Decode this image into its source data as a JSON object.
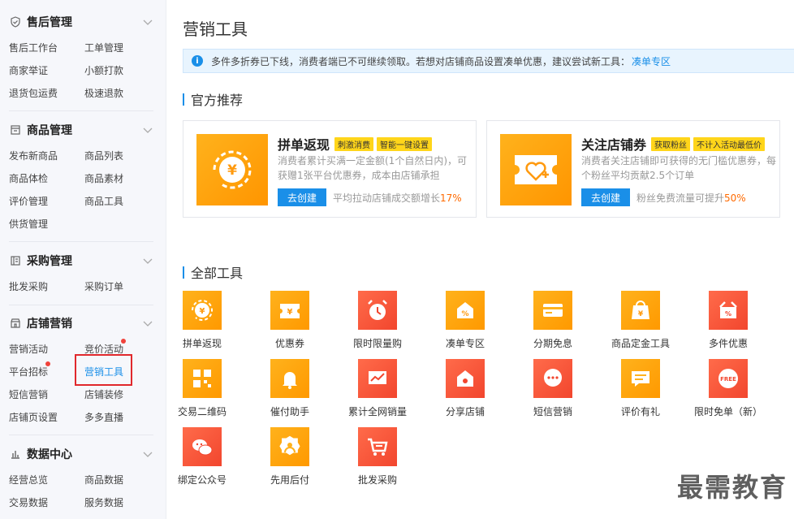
{
  "sidebar": {
    "sections": [
      {
        "title": "售后管理",
        "icon": "shield-check-icon",
        "items": [
          "售后工作台",
          "工单管理",
          "商家举证",
          "小额打款",
          "退货包运费",
          "极速退款"
        ]
      },
      {
        "title": "商品管理",
        "icon": "box-icon",
        "items": [
          "发布新商品",
          "商品列表",
          "商品体检",
          "商品素材",
          "评价管理",
          "商品工具",
          "供货管理"
        ]
      },
      {
        "title": "采购管理",
        "icon": "list-icon",
        "items": [
          "批发采购",
          "采购订单"
        ]
      },
      {
        "title": "店铺营销",
        "icon": "storefront-icon",
        "items": [
          "营销活动",
          "竞价活动",
          "平台招标",
          "营销工具",
          "短信营销",
          "店铺装修",
          "店铺页设置",
          "多多直播"
        ]
      },
      {
        "title": "数据中心",
        "icon": "bar-chart-icon",
        "items": [
          "经营总览",
          "商品数据",
          "交易数据",
          "服务数据"
        ]
      }
    ]
  },
  "main": {
    "title": "营销工具",
    "notice": {
      "text": "多件多折券已下线，消费者端已不可继续领取。若想对店铺商品设置凑单优惠，建议尝试新工具：",
      "link": "凑单专区"
    },
    "recommend_title": "官方推荐",
    "cards": [
      {
        "title": "拼单返现",
        "tags": [
          "刺激消费",
          "智能一键设置"
        ],
        "desc": "消费者累计买满一定金额(1个自然日内)，可获赠1张平台优惠券，成本由店铺承担",
        "button": "去创建",
        "stat_prefix": "平均拉动店铺成交额增长",
        "stat_value": "17%"
      },
      {
        "title": "关注店铺券",
        "tags": [
          "获取粉丝",
          "不计入活动最低价"
        ],
        "desc": "消费者关注店铺即可获得的无门槛优惠券，每个粉丝平均贡献2.5个订单",
        "button": "去创建",
        "stat_prefix": "粉丝免费流量可提升",
        "stat_value": "50%"
      }
    ],
    "all_tools_title": "全部工具",
    "tools": [
      {
        "label": "拼单返现",
        "icon": "cashback-icon"
      },
      {
        "label": "优惠券",
        "icon": "coupon-icon"
      },
      {
        "label": "限时限量购",
        "icon": "alarm-clock-icon"
      },
      {
        "label": "凑单专区",
        "icon": "discount-house-icon"
      },
      {
        "label": "分期免息",
        "icon": "credit-card-icon"
      },
      {
        "label": "商品定金工具",
        "icon": "deposit-bag-icon"
      },
      {
        "label": "多件优惠",
        "icon": "multi-discount-icon"
      },
      {
        "label": "交易二维码",
        "icon": "qrcode-icon"
      },
      {
        "label": "催付助手",
        "icon": "bell-icon"
      },
      {
        "label": "累计全网销量",
        "icon": "trend-chart-icon"
      },
      {
        "label": "分享店铺",
        "icon": "share-shop-icon"
      },
      {
        "label": "短信营销",
        "icon": "sms-bubble-icon"
      },
      {
        "label": "评价有礼",
        "icon": "review-gift-icon"
      },
      {
        "label": "限时免单（新）",
        "icon": "free-badge-icon",
        "badge": "FREE"
      },
      {
        "label": "绑定公众号",
        "icon": "wechat-icon"
      },
      {
        "label": "先用后付",
        "icon": "pay-later-icon"
      },
      {
        "label": "批发采购",
        "icon": "cart-icon"
      }
    ]
  },
  "watermark": "最需教育"
}
